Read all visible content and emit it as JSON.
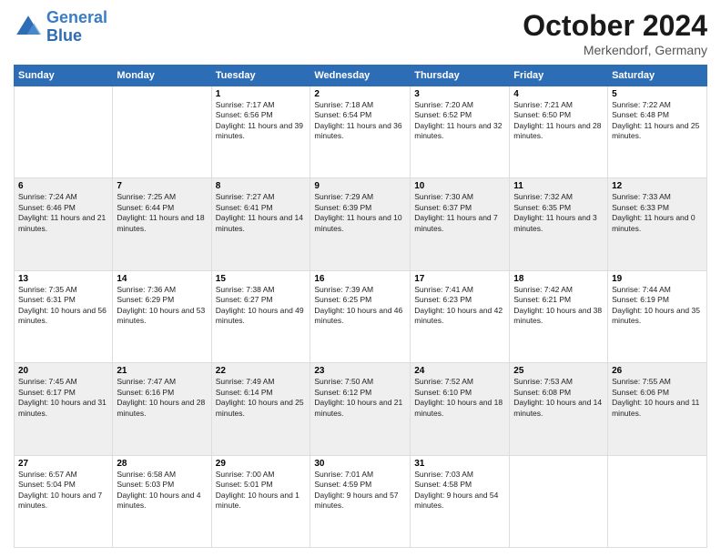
{
  "header": {
    "logo_general": "General",
    "logo_blue": "Blue",
    "month_title": "October 2024",
    "location": "Merkendorf, Germany"
  },
  "days_of_week": [
    "Sunday",
    "Monday",
    "Tuesday",
    "Wednesday",
    "Thursday",
    "Friday",
    "Saturday"
  ],
  "weeks": [
    [
      {
        "day": "",
        "info": ""
      },
      {
        "day": "",
        "info": ""
      },
      {
        "day": "1",
        "info": "Sunrise: 7:17 AM\nSunset: 6:56 PM\nDaylight: 11 hours and 39 minutes."
      },
      {
        "day": "2",
        "info": "Sunrise: 7:18 AM\nSunset: 6:54 PM\nDaylight: 11 hours and 36 minutes."
      },
      {
        "day": "3",
        "info": "Sunrise: 7:20 AM\nSunset: 6:52 PM\nDaylight: 11 hours and 32 minutes."
      },
      {
        "day": "4",
        "info": "Sunrise: 7:21 AM\nSunset: 6:50 PM\nDaylight: 11 hours and 28 minutes."
      },
      {
        "day": "5",
        "info": "Sunrise: 7:22 AM\nSunset: 6:48 PM\nDaylight: 11 hours and 25 minutes."
      }
    ],
    [
      {
        "day": "6",
        "info": "Sunrise: 7:24 AM\nSunset: 6:46 PM\nDaylight: 11 hours and 21 minutes."
      },
      {
        "day": "7",
        "info": "Sunrise: 7:25 AM\nSunset: 6:44 PM\nDaylight: 11 hours and 18 minutes."
      },
      {
        "day": "8",
        "info": "Sunrise: 7:27 AM\nSunset: 6:41 PM\nDaylight: 11 hours and 14 minutes."
      },
      {
        "day": "9",
        "info": "Sunrise: 7:29 AM\nSunset: 6:39 PM\nDaylight: 11 hours and 10 minutes."
      },
      {
        "day": "10",
        "info": "Sunrise: 7:30 AM\nSunset: 6:37 PM\nDaylight: 11 hours and 7 minutes."
      },
      {
        "day": "11",
        "info": "Sunrise: 7:32 AM\nSunset: 6:35 PM\nDaylight: 11 hours and 3 minutes."
      },
      {
        "day": "12",
        "info": "Sunrise: 7:33 AM\nSunset: 6:33 PM\nDaylight: 11 hours and 0 minutes."
      }
    ],
    [
      {
        "day": "13",
        "info": "Sunrise: 7:35 AM\nSunset: 6:31 PM\nDaylight: 10 hours and 56 minutes."
      },
      {
        "day": "14",
        "info": "Sunrise: 7:36 AM\nSunset: 6:29 PM\nDaylight: 10 hours and 53 minutes."
      },
      {
        "day": "15",
        "info": "Sunrise: 7:38 AM\nSunset: 6:27 PM\nDaylight: 10 hours and 49 minutes."
      },
      {
        "day": "16",
        "info": "Sunrise: 7:39 AM\nSunset: 6:25 PM\nDaylight: 10 hours and 46 minutes."
      },
      {
        "day": "17",
        "info": "Sunrise: 7:41 AM\nSunset: 6:23 PM\nDaylight: 10 hours and 42 minutes."
      },
      {
        "day": "18",
        "info": "Sunrise: 7:42 AM\nSunset: 6:21 PM\nDaylight: 10 hours and 38 minutes."
      },
      {
        "day": "19",
        "info": "Sunrise: 7:44 AM\nSunset: 6:19 PM\nDaylight: 10 hours and 35 minutes."
      }
    ],
    [
      {
        "day": "20",
        "info": "Sunrise: 7:45 AM\nSunset: 6:17 PM\nDaylight: 10 hours and 31 minutes."
      },
      {
        "day": "21",
        "info": "Sunrise: 7:47 AM\nSunset: 6:16 PM\nDaylight: 10 hours and 28 minutes."
      },
      {
        "day": "22",
        "info": "Sunrise: 7:49 AM\nSunset: 6:14 PM\nDaylight: 10 hours and 25 minutes."
      },
      {
        "day": "23",
        "info": "Sunrise: 7:50 AM\nSunset: 6:12 PM\nDaylight: 10 hours and 21 minutes."
      },
      {
        "day": "24",
        "info": "Sunrise: 7:52 AM\nSunset: 6:10 PM\nDaylight: 10 hours and 18 minutes."
      },
      {
        "day": "25",
        "info": "Sunrise: 7:53 AM\nSunset: 6:08 PM\nDaylight: 10 hours and 14 minutes."
      },
      {
        "day": "26",
        "info": "Sunrise: 7:55 AM\nSunset: 6:06 PM\nDaylight: 10 hours and 11 minutes."
      }
    ],
    [
      {
        "day": "27",
        "info": "Sunrise: 6:57 AM\nSunset: 5:04 PM\nDaylight: 10 hours and 7 minutes."
      },
      {
        "day": "28",
        "info": "Sunrise: 6:58 AM\nSunset: 5:03 PM\nDaylight: 10 hours and 4 minutes."
      },
      {
        "day": "29",
        "info": "Sunrise: 7:00 AM\nSunset: 5:01 PM\nDaylight: 10 hours and 1 minute."
      },
      {
        "day": "30",
        "info": "Sunrise: 7:01 AM\nSunset: 4:59 PM\nDaylight: 9 hours and 57 minutes."
      },
      {
        "day": "31",
        "info": "Sunrise: 7:03 AM\nSunset: 4:58 PM\nDaylight: 9 hours and 54 minutes."
      },
      {
        "day": "",
        "info": ""
      },
      {
        "day": "",
        "info": ""
      }
    ]
  ]
}
